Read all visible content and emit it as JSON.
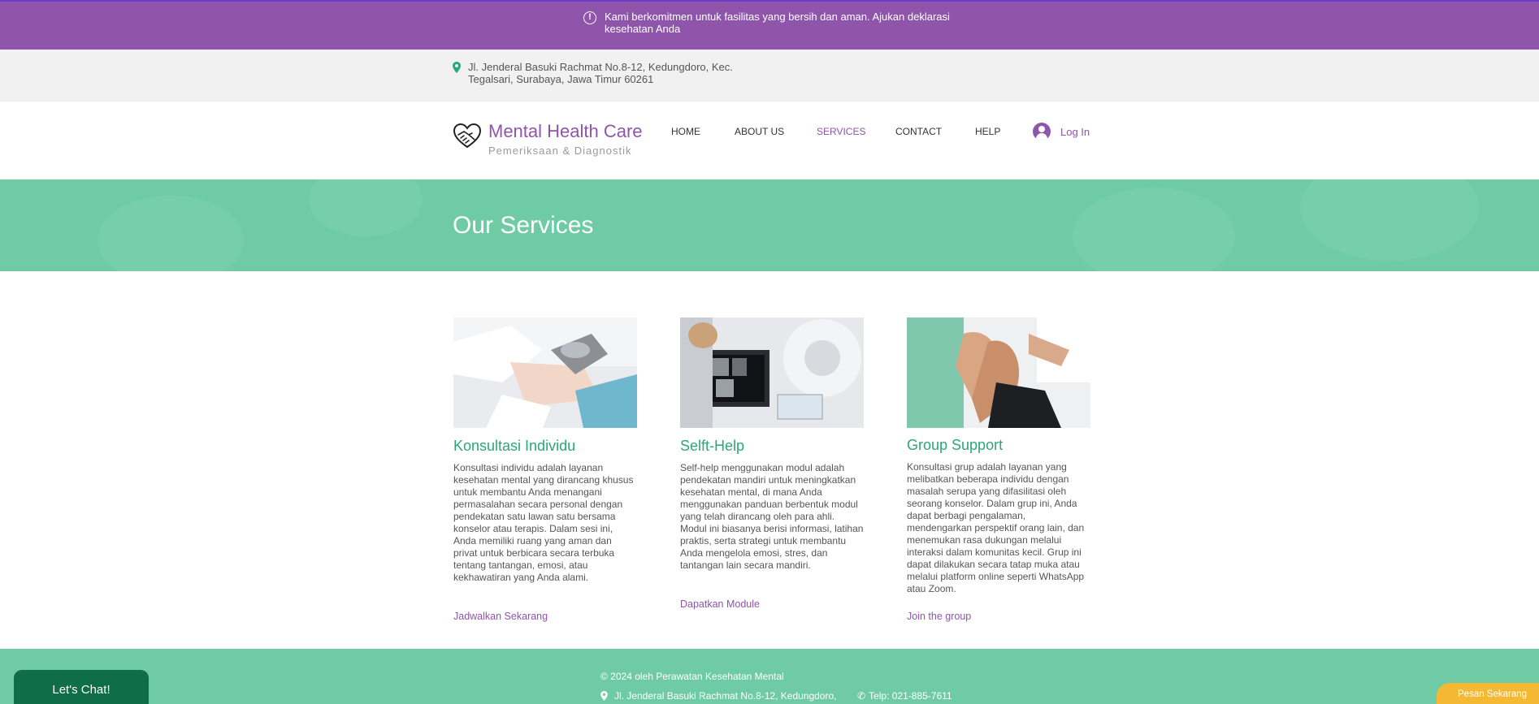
{
  "banner": {
    "icon": "alert-circle-icon",
    "text": "Kami berkomitmen untuk fasilitas yang bersih dan aman. Ajukan deklarasi kesehatan Anda"
  },
  "address_bar": {
    "icon": "location-pin-icon",
    "text": "Jl. Jenderal Basuki Rachmat No.8-12, Kedungdoro, Kec. Tegalsari, Surabaya, Jawa Timur 60261"
  },
  "header": {
    "logo_icon": "heart-hands-icon",
    "brand_title": "Mental Health Care",
    "brand_subtitle": "Pemeriksaan & Diagnostik",
    "nav": [
      {
        "label": "HOME",
        "active": false
      },
      {
        "label": "ABOUT US",
        "active": false
      },
      {
        "label": "SERVICES",
        "active": true
      },
      {
        "label": "CONTACT",
        "active": false
      },
      {
        "label": "HELP",
        "active": false
      }
    ],
    "login_icon": "user-avatar-icon",
    "login_label": "Log In"
  },
  "hero": {
    "title": "Our Services"
  },
  "services": [
    {
      "title": "Konsultasi Individu",
      "text": "Konsultasi individu adalah layanan kesehatan mental yang dirancang khusus untuk membantu Anda menangani permasalahan secara personal dengan pendekatan satu lawan satu bersama konselor atau terapis. Dalam sesi ini, Anda memiliki ruang yang aman dan privat untuk berbicara secara terbuka tentang tantangan, emosi, atau kekhawatiran yang Anda alami.",
      "link": "Jadwalkan Sekarang"
    },
    {
      "title": "Selft-Help",
      "text": "Self-help menggunakan modul adalah pendekatan mandiri untuk meningkatkan kesehatan mental, di mana Anda menggunakan panduan berbentuk modul yang telah dirancang oleh para ahli. Modul ini biasanya berisi informasi, latihan praktis, serta strategi untuk membantu Anda mengelola emosi, stres, dan tantangan lain secara mandiri.",
      "link": "Dapatkan Module"
    },
    {
      "title": "Group Support",
      "text": "Konsultasi grup adalah layanan yang melibatkan beberapa individu dengan masalah serupa yang difasilitasi oleh seorang konselor. Dalam grup ini, Anda dapat berbagi pengalaman, mendengarkan perspektif orang lain, dan menemukan rasa dukungan melalui interaksi dalam komunitas kecil. Grup ini dapat dilakukan secara tatap muka atau melalui platform online seperti WhatsApp atau Zoom.",
      "link": "Join the group"
    }
  ],
  "footer": {
    "copyright": "© 2024 oleh Perawatan Kesehatan Mental",
    "address": "Jl. Jenderal Basuki Rachmat No.8-12, Kedungdoro,",
    "phone": "Telp: 021-885-7611",
    "address_icon": "location-pin-icon",
    "phone_icon": "phone-icon"
  },
  "chat_widget": {
    "label": "Let's Chat!"
  },
  "order_button": {
    "label": "Pesan Sekarang"
  },
  "colors": {
    "purple": "#8e55ab",
    "green": "#6fcba5",
    "title_green": "#2aa876",
    "chat_green": "#0f6d47",
    "order_yellow": "#f5b833"
  }
}
